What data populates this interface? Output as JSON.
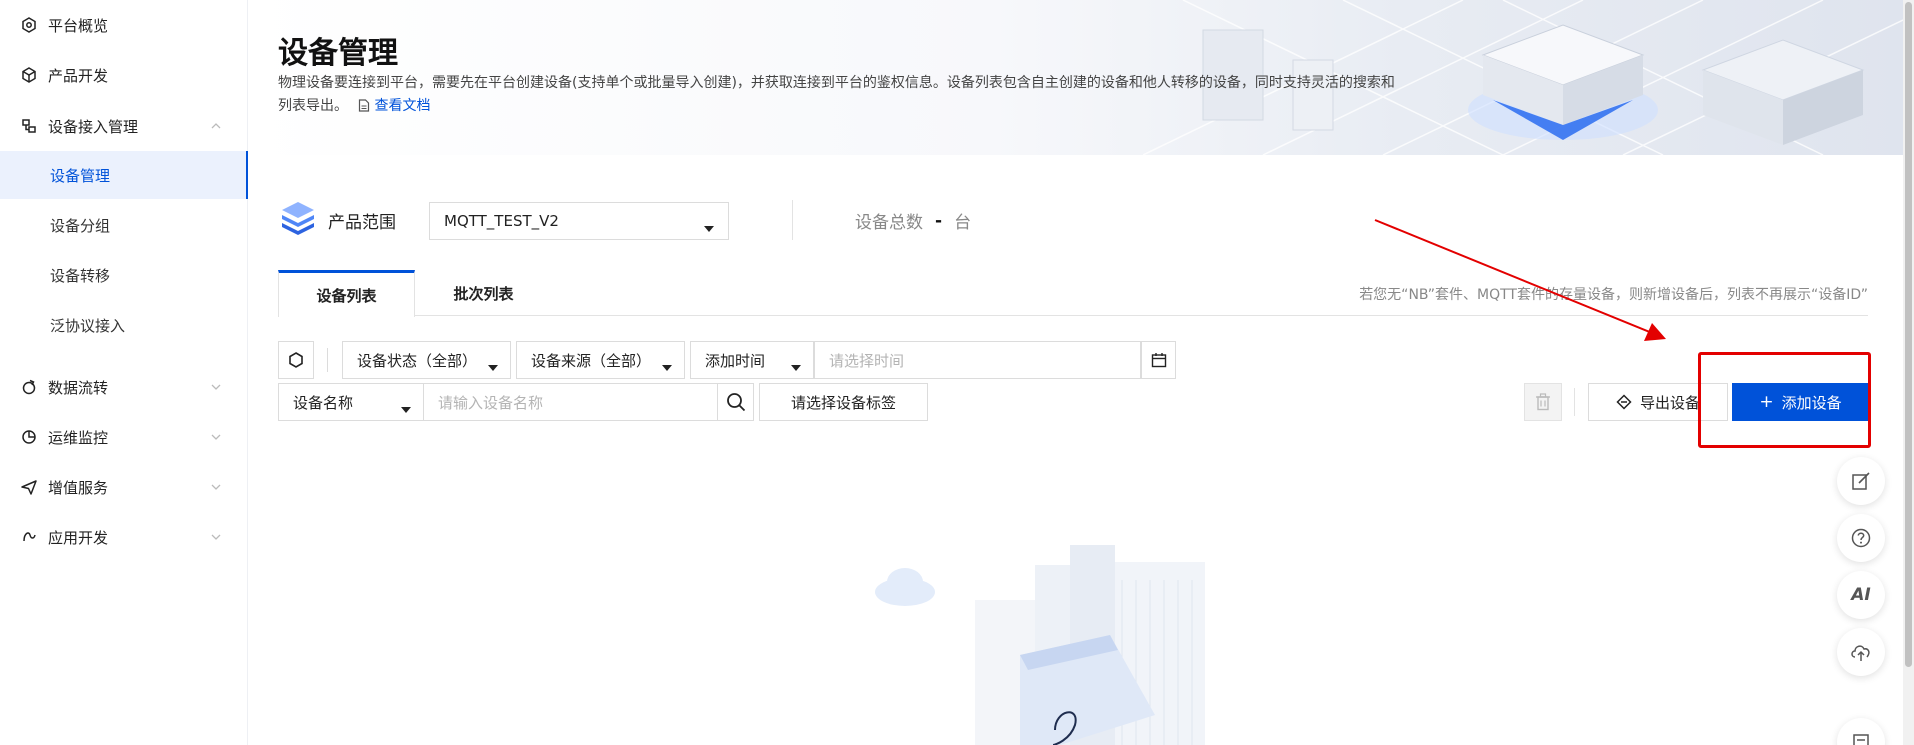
{
  "sidebar": {
    "items": [
      {
        "label": "平台概览",
        "icon": "dashboard-icon"
      },
      {
        "label": "产品开发",
        "icon": "cube-icon"
      },
      {
        "label": "设备接入管理",
        "icon": "device-access-icon",
        "expanded": true,
        "children": [
          {
            "label": "设备管理",
            "active": true
          },
          {
            "label": "设备分组"
          },
          {
            "label": "设备转移"
          },
          {
            "label": "泛协议接入"
          }
        ]
      },
      {
        "label": "数据流转",
        "icon": "data-flow-icon"
      },
      {
        "label": "运维监控",
        "icon": "monitor-icon"
      },
      {
        "label": "增值服务",
        "icon": "send-icon"
      },
      {
        "label": "应用开发",
        "icon": "app-dev-icon"
      }
    ]
  },
  "header": {
    "title": "设备管理",
    "description": "物理设备要连接到平台，需要先在平台创建设备(支持单个或批量导入创建)，并获取连接到平台的鉴权信息。设备列表包含自主创建的设备和他人转移的设备，同时支持灵活的搜索和列表导出。",
    "doc_link": "查看文档"
  },
  "scope": {
    "label": "产品范围",
    "selected": "MQTT_TEST_V2",
    "total_label": "设备总数",
    "total_value": "-",
    "total_unit": "台"
  },
  "tabs": {
    "items": [
      {
        "label": "设备列表",
        "active": true
      },
      {
        "label": "批次列表",
        "active": false
      }
    ],
    "note": "若您无“NB”套件、MQTT套件的存量设备，则新增设备后，列表不再展示“设备ID”"
  },
  "filters": {
    "status": "设备状态（全部）",
    "source": "设备来源（全部）",
    "time_field": "添加时间",
    "time_placeholder": "请选择时间",
    "name_field": "设备名称",
    "name_placeholder": "请输入设备名称",
    "tag_button": "请选择设备标签"
  },
  "actions": {
    "export": "导出设备",
    "add": "添加设备"
  },
  "float_tools": [
    "edit-icon",
    "help-icon",
    "AI",
    "cloud-upload-icon",
    "collapse-icon"
  ],
  "colors": {
    "primary": "#0052d9",
    "annotation_red": "#e30000"
  }
}
